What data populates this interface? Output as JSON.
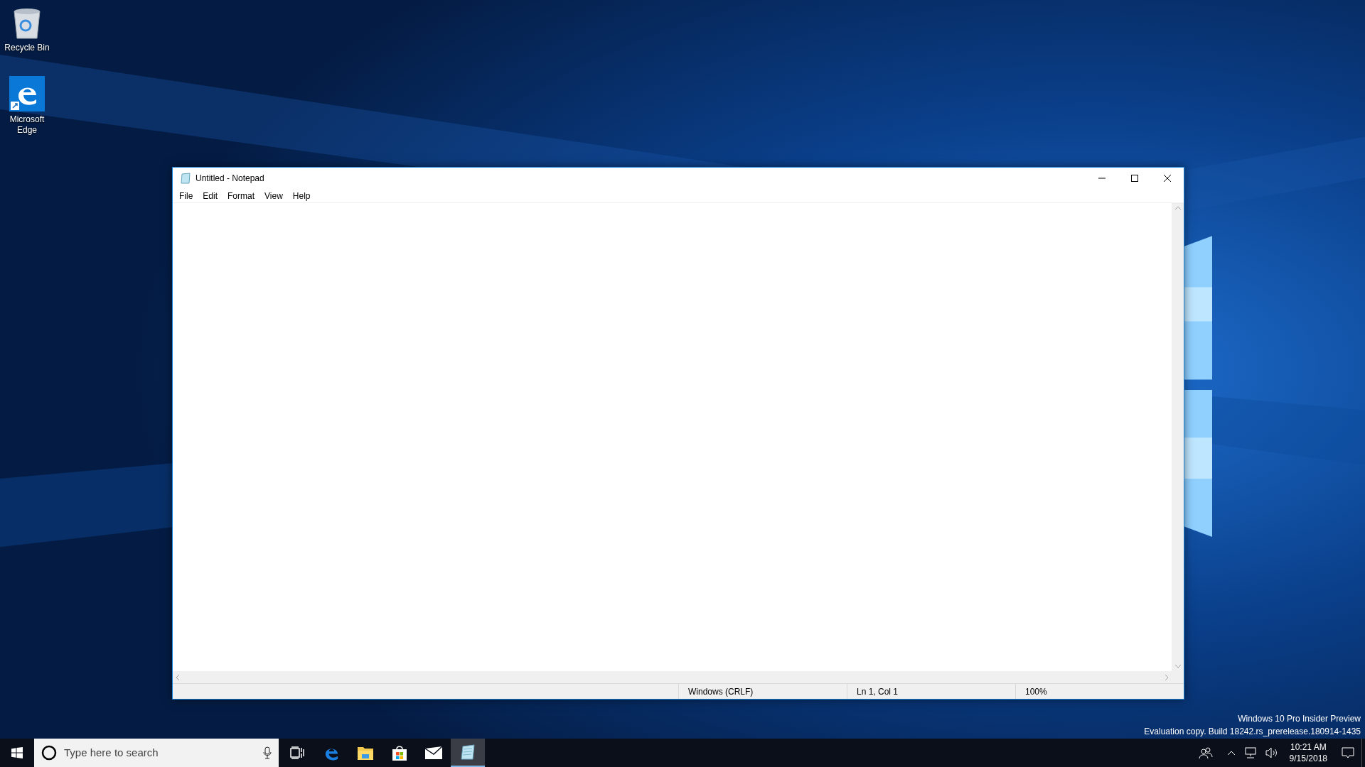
{
  "desktop_icons": [
    {
      "kind": "recycle",
      "label": "Recycle Bin"
    },
    {
      "kind": "edge",
      "label": "Microsoft Edge"
    }
  ],
  "window": {
    "title": "Untitled - Notepad",
    "menu": [
      "File",
      "Edit",
      "Format",
      "View",
      "Help"
    ],
    "status_bar": [
      "Windows (CRLF)",
      "Ln 1, Col 1",
      "100%"
    ]
  },
  "os_notice": [
    "Windows 10 Pro Insider Preview",
    "Evaluation copy. Build 18242.rs_prerelease.180914-1435"
  ],
  "taskbar": {
    "search": {
      "placeholder": "Type here to search"
    },
    "apps": [
      {
        "kind": "taskview",
        "selected": false
      },
      {
        "kind": "edge",
        "selected": false
      },
      {
        "kind": "explorer",
        "selected": false
      },
      {
        "kind": "store",
        "selected": false
      },
      {
        "kind": "mail",
        "selected": false
      },
      {
        "kind": "notepad",
        "selected": true
      }
    ],
    "clock": {
      "time": "10:21 AM",
      "date": "9/15/2018"
    }
  }
}
